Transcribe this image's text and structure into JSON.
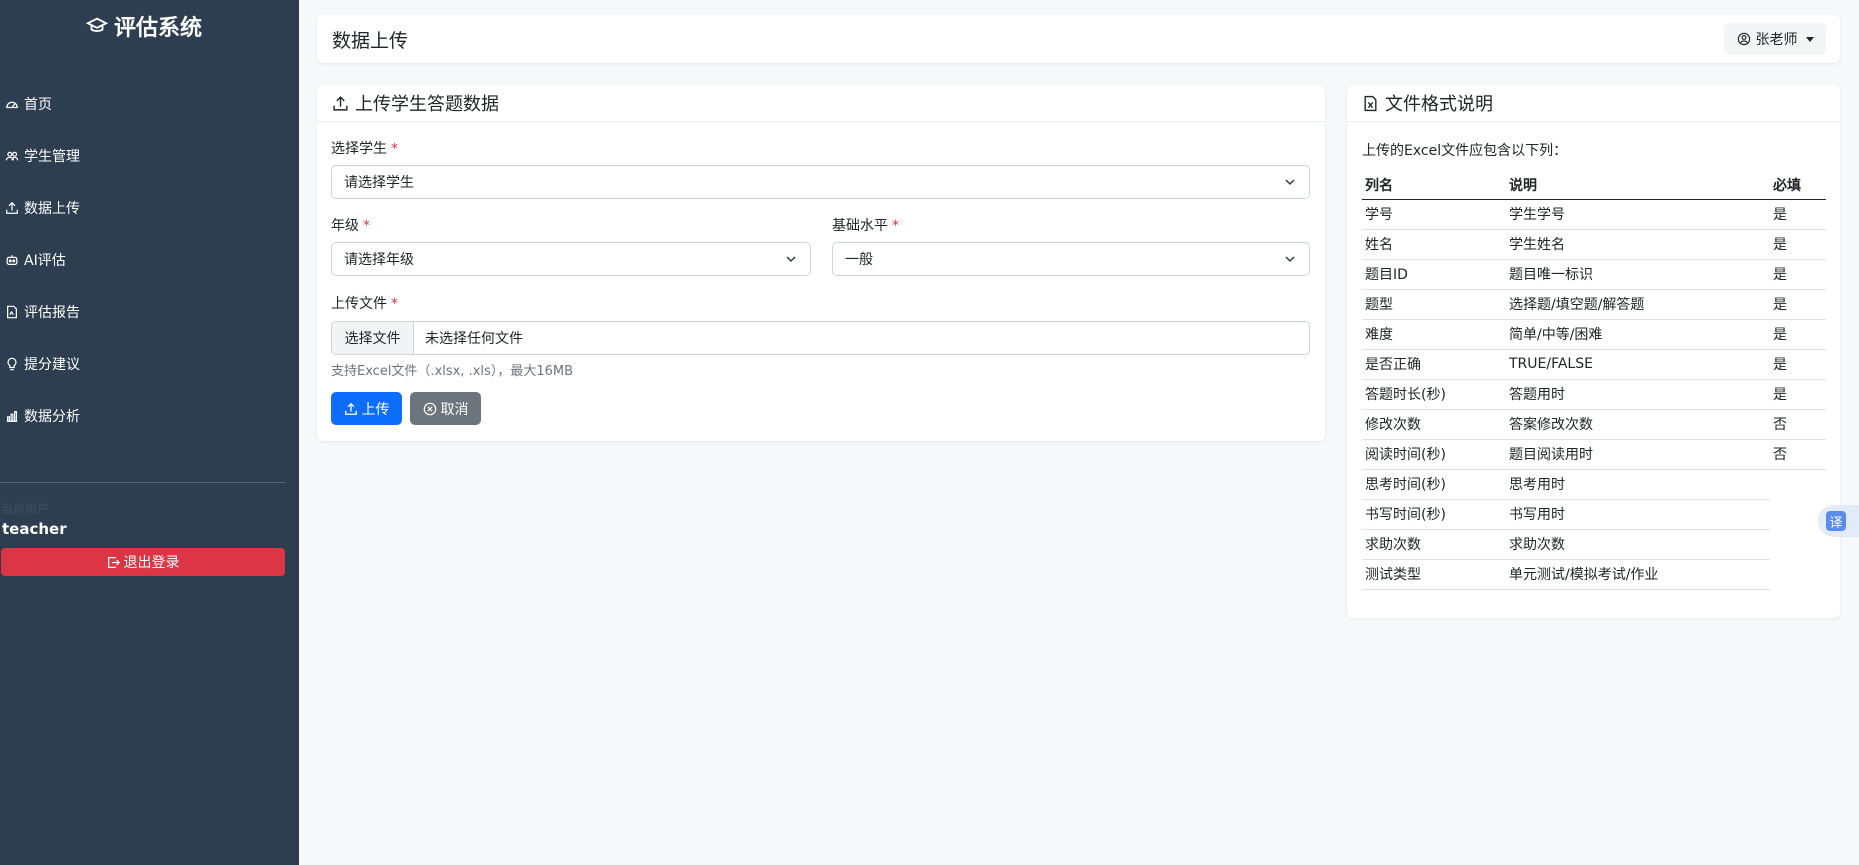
{
  "sidebar": {
    "brand": "评估系统",
    "items": [
      {
        "label": "首页",
        "icon": "speedometer-icon"
      },
      {
        "label": "学生管理",
        "icon": "people-icon"
      },
      {
        "label": "数据上传",
        "icon": "upload-icon"
      },
      {
        "label": "AI评估",
        "icon": "robot-icon"
      },
      {
        "label": "评估报告",
        "icon": "document-icon"
      },
      {
        "label": "提分建议",
        "icon": "lightbulb-icon"
      },
      {
        "label": "数据分析",
        "icon": "bar-chart-icon"
      }
    ],
    "user_caption": "当前用户",
    "user_name": "teacher",
    "logout_label": "退出登录"
  },
  "header": {
    "title": "数据上传",
    "user_menu_label": "张老师"
  },
  "upload": {
    "title": "上传学生答题数据",
    "student_label": "选择学生",
    "student_value": "请选择学生",
    "grade_label": "年级",
    "grade_value": "请选择年级",
    "level_label": "基础水平",
    "level_value": "一般",
    "file_label": "上传文件",
    "file_button": "选择文件",
    "file_name": "未选择任何文件",
    "help_text": "支持Excel文件（.xlsx, .xls），最大16MB",
    "upload_button": "上传",
    "cancel_button": "取消",
    "required_mark": "*"
  },
  "format": {
    "title": "文件格式说明",
    "intro": "上传的Excel文件应包含以下列：",
    "columns": [
      "列名",
      "说明",
      "必填"
    ],
    "rows": [
      [
        "学号",
        "学生学号",
        "是"
      ],
      [
        "姓名",
        "学生姓名",
        "是"
      ],
      [
        "题目ID",
        "题目唯一标识",
        "是"
      ],
      [
        "题型",
        "选择题/填空题/解答题",
        "是"
      ],
      [
        "难度",
        "简单/中等/困难",
        "是"
      ],
      [
        "是否正确",
        "TRUE/FALSE",
        "是"
      ],
      [
        "答题时长(秒)",
        "答题用时",
        "是"
      ],
      [
        "修改次数",
        "答案修改次数",
        "否"
      ],
      [
        "阅读时间(秒)",
        "题目阅读用时",
        "否"
      ],
      [
        "思考时间(秒)",
        "思考用时",
        ""
      ],
      [
        "书写时间(秒)",
        "书写用时",
        ""
      ],
      [
        "求助次数",
        "求助次数",
        ""
      ],
      [
        "测试类型",
        "单元测试/模拟考试/作业",
        ""
      ]
    ]
  },
  "translate_widget": "译",
  "colors": {
    "sidebar_bg": "#2c3e50",
    "primary": "#0d6efd",
    "danger": "#dc3545",
    "secondary": "#6c757d"
  }
}
